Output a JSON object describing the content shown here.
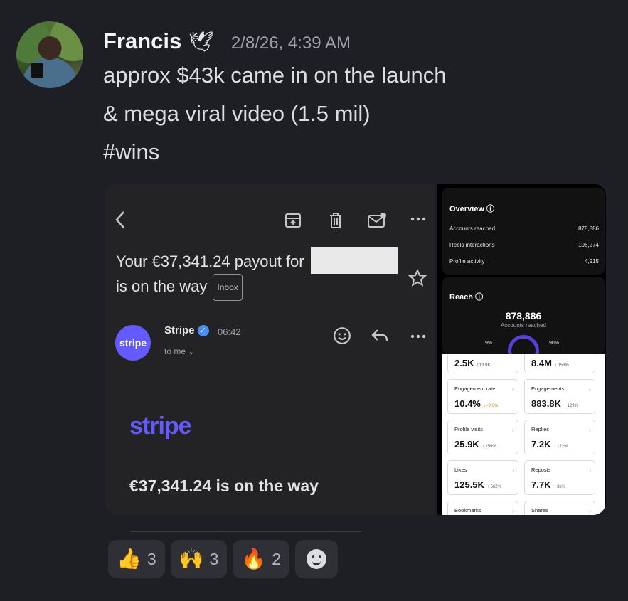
{
  "message": {
    "username": "Francis",
    "username_emoji": "🕊",
    "timestamp": "2/8/26, 4:39 AM",
    "lines": [
      "approx $43k came in on the launch",
      "& mega viral video (1.5 mil)",
      "#wins"
    ]
  },
  "email_screenshot": {
    "subject_line1": "Your €37,341.24 payout for",
    "subject_line2": "is on the way",
    "label_chip": "Inbox",
    "sender_avatar_text": "stripe",
    "sender_name": "Stripe",
    "sender_time": "06:42",
    "recipient": "to me",
    "logo_text": "stripe",
    "headline": "€37,341.24 is on the way",
    "icons": [
      "back-arrow-icon",
      "archive-icon",
      "trash-icon",
      "mark-unread-icon",
      "more-icon",
      "star-icon",
      "emoji-icon",
      "reply-icon",
      "more-icon"
    ]
  },
  "insights_screenshot": {
    "overview": {
      "title": "Overview",
      "rows": [
        {
          "label": "Accounts reached",
          "value": "878,886"
        },
        {
          "label": "Reels interactions",
          "value": "108,274"
        },
        {
          "label": "Profile activity",
          "value": "4,915"
        }
      ]
    },
    "reach": {
      "title": "Reach",
      "value": "878,886",
      "sublabel": "Accounts reached",
      "left_pct": "9%",
      "right_pct": "90%"
    },
    "stats": [
      {
        "label": "",
        "value": "2.5K",
        "change": "/ 13.9K"
      },
      {
        "label": "",
        "value": "8.4M",
        "change": "↑ 153%"
      },
      {
        "label": "Engagement rate",
        "value": "10.4%",
        "change": "↓ -9.3%"
      },
      {
        "label": "Engagements",
        "value": "883.8K",
        "change": "↑ 129%"
      },
      {
        "label": "Profile visits",
        "value": "25.9K",
        "change": "↑ 159%"
      },
      {
        "label": "Replies",
        "value": "7.2K",
        "change": "↑ 122%"
      },
      {
        "label": "Likes",
        "value": "125.5K",
        "change": "↑ 562%"
      },
      {
        "label": "Reposts",
        "value": "7.7K",
        "change": "↑ 3k%"
      },
      {
        "label": "Bookmarks",
        "value": "",
        "change": ""
      },
      {
        "label": "Shares",
        "value": "",
        "change": ""
      }
    ]
  },
  "reactions": [
    {
      "emoji": "👍",
      "count": "3"
    },
    {
      "emoji": "🙌",
      "count": "3"
    },
    {
      "emoji": "🔥",
      "count": "2"
    }
  ],
  "colors": {
    "background": "#1e1f24",
    "stripe_brand": "#635bff",
    "reaction_bg": "#2e3035"
  }
}
